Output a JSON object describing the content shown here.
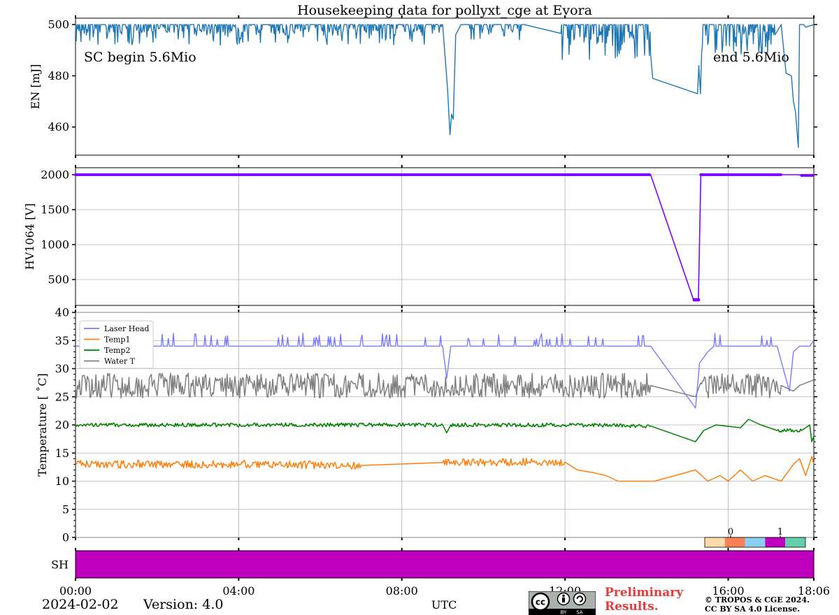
{
  "figure": {
    "title": "Housekeeping data for pollyxt_cge at Evora",
    "date": "2024-02-02",
    "version": "Version: 4.0",
    "xlabel": "UTC",
    "preliminary": [
      "Preliminary",
      "Results."
    ],
    "copyright": [
      "© TROPOS & CGE 2024.",
      "CC BY SA 4.0 License."
    ],
    "cc_badge": {
      "left": "BY",
      "right": "SA"
    }
  },
  "chart_data": [
    {
      "id": "energy",
      "type": "line",
      "ylabel": "EN [mJ]",
      "ylim": [
        449,
        502.5
      ],
      "yticks": [
        460,
        480,
        500
      ],
      "grid": false,
      "annotations": [
        "SC begin 5.6Mio",
        "end 5.6Mio"
      ],
      "series": [
        {
          "color": "#1f77b4",
          "noise_segments": [
            [
              0.0,
              9.0,
              492,
              500
            ],
            [
              9.6,
              11.0,
              494,
              500
            ],
            [
              11.9,
              14.1,
              486,
              500
            ],
            [
              15.35,
              17.15,
              488,
              500
            ]
          ],
          "points": [
            [
              9.0,
              496
            ],
            [
              9.12,
              475
            ],
            [
              9.18,
              457
            ],
            [
              9.22,
              465
            ],
            [
              9.26,
              463
            ],
            [
              9.32,
              496
            ],
            [
              9.45,
              500
            ],
            [
              11.9,
              500
            ],
            [
              14.1,
              490
            ],
            [
              14.15,
              479
            ],
            [
              15.25,
              473
            ],
            [
              15.28,
              484
            ],
            [
              15.32,
              473
            ],
            [
              15.35,
              500
            ],
            [
              17.3,
              500
            ],
            [
              17.42,
              481
            ],
            [
              17.55,
              480
            ],
            [
              17.6,
              470
            ],
            [
              17.65,
              466
            ],
            [
              17.68,
              460
            ],
            [
              17.72,
              452
            ],
            [
              17.75,
              500
            ],
            [
              17.85,
              500
            ],
            [
              17.9,
              499
            ],
            [
              18.1,
              500
            ]
          ]
        }
      ]
    },
    {
      "id": "hv1064",
      "type": "line",
      "ylabel": "HV1064 [V]",
      "ylim": [
        130,
        2100
      ],
      "yticks": [
        500,
        1000,
        1500,
        2000
      ],
      "grid": true,
      "series": [
        {
          "color": "#7f00ff",
          "markers": true,
          "points": [
            [
              0,
              2000
            ],
            [
              14.1,
              2000
            ],
            [
              15.15,
              210
            ],
            [
              15.27,
              210
            ],
            [
              15.33,
              2000
            ],
            [
              17.3,
              2000
            ],
            [
              17.55,
              2000
            ],
            [
              17.7,
              2000
            ],
            [
              17.9,
              1990
            ],
            [
              18.1,
              1995
            ]
          ]
        }
      ]
    },
    {
      "id": "temperature",
      "type": "line",
      "ylabel": "Temperature [$^\\circ C$]",
      "ylim": [
        0,
        40
      ],
      "yticks": [
        0,
        5,
        10,
        15,
        20,
        25,
        30,
        35,
        40
      ],
      "grid": true,
      "legend": "top-left",
      "series": [
        {
          "name": "Laser Head",
          "color": "#7b7bff",
          "base": 34,
          "spikes": true,
          "points": [
            [
              0,
              34
            ],
            [
              9.0,
              34
            ],
            [
              9.1,
              28.3
            ],
            [
              9.2,
              34
            ],
            [
              14.1,
              34
            ],
            [
              15.2,
              23
            ],
            [
              15.3,
              31
            ],
            [
              15.5,
              33
            ],
            [
              15.65,
              34
            ],
            [
              17.2,
              34
            ],
            [
              17.5,
              26
            ],
            [
              17.6,
              33
            ],
            [
              17.75,
              34
            ],
            [
              18.0,
              34
            ],
            [
              18.1,
              35
            ]
          ]
        },
        {
          "name": "Temp1",
          "color": "#ff7f0e",
          "points": [
            [
              0,
              13
            ],
            [
              4,
              13
            ],
            [
              7,
              12.8
            ],
            [
              9,
              13.3
            ],
            [
              12,
              13.4
            ],
            [
              12.3,
              12
            ],
            [
              12.7,
              11.5
            ],
            [
              13.0,
              11
            ],
            [
              13.3,
              10
            ],
            [
              13.6,
              10
            ],
            [
              14.1,
              10
            ],
            [
              14.2,
              10
            ],
            [
              15.2,
              12
            ],
            [
              15.5,
              10
            ],
            [
              15.8,
              11
            ],
            [
              16.0,
              10
            ],
            [
              16.3,
              12
            ],
            [
              16.6,
              10
            ],
            [
              16.9,
              11
            ],
            [
              17.3,
              10
            ],
            [
              17.6,
              13
            ],
            [
              17.75,
              14
            ],
            [
              17.9,
              11
            ],
            [
              18.05,
              14.4
            ],
            [
              18.1,
              13
            ]
          ]
        },
        {
          "name": "Temp2",
          "color": "#008000",
          "points": [
            [
              0,
              20
            ],
            [
              9.0,
              20
            ],
            [
              9.1,
              18.6
            ],
            [
              9.2,
              20
            ],
            [
              12.0,
              20
            ],
            [
              14.1,
              19.8
            ],
            [
              15.2,
              17
            ],
            [
              15.4,
              19
            ],
            [
              15.7,
              20
            ],
            [
              16.3,
              19.5
            ],
            [
              16.5,
              21
            ],
            [
              16.8,
              20
            ],
            [
              17.2,
              19
            ],
            [
              17.8,
              19
            ],
            [
              18.0,
              20
            ],
            [
              18.05,
              17
            ],
            [
              18.1,
              18
            ]
          ]
        },
        {
          "name": "Water T",
          "color": "#808080",
          "points": [
            [
              0,
              27
            ],
            [
              14.1,
              27
            ],
            [
              15.2,
              25
            ],
            [
              15.3,
              27
            ],
            [
              17.3,
              27
            ],
            [
              17.6,
              26
            ],
            [
              17.75,
              27
            ],
            [
              18.1,
              28
            ]
          ]
        }
      ]
    },
    {
      "id": "sh",
      "type": "heatmap",
      "ylabel": "SH",
      "fill_color": "#be00be",
      "colorbar": {
        "ticks": [
          "0",
          "1"
        ],
        "colors": [
          "#fddcaa",
          "#fa8058",
          "#8bcfee",
          "#be00be",
          "#63cfab"
        ]
      }
    }
  ],
  "x_axis": {
    "tick_labels": [
      "00:00",
      "04:00",
      "08:00",
      "12:00",
      "16:00",
      "18:06"
    ],
    "tick_values_hours": [
      0,
      4,
      8,
      12,
      16,
      18.1
    ],
    "range_hours": [
      0,
      18.1
    ]
  }
}
